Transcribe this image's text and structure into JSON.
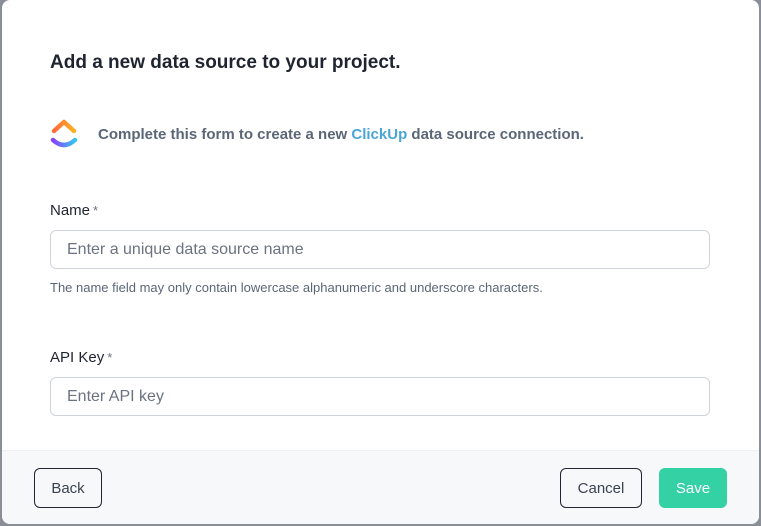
{
  "modal": {
    "title": "Add a new data source to your project.",
    "intro": {
      "prefix": "Complete this form to create a new ",
      "link": "ClickUp",
      "suffix": " data source connection."
    }
  },
  "form": {
    "name": {
      "label": "Name",
      "required_mark": "*",
      "placeholder": "Enter a unique data source name",
      "value": "",
      "help": "The name field may only contain lowercase alphanumeric and underscore characters."
    },
    "api_key": {
      "label": "API Key",
      "required_mark": "*",
      "placeholder": "Enter API key",
      "value": ""
    }
  },
  "footer": {
    "back_label": "Back",
    "cancel_label": "Cancel",
    "save_label": "Save"
  },
  "icons": {
    "logo": "clickup-logo-icon"
  },
  "colors": {
    "accent": "#33d1a4",
    "link": "#4aa6d6"
  }
}
